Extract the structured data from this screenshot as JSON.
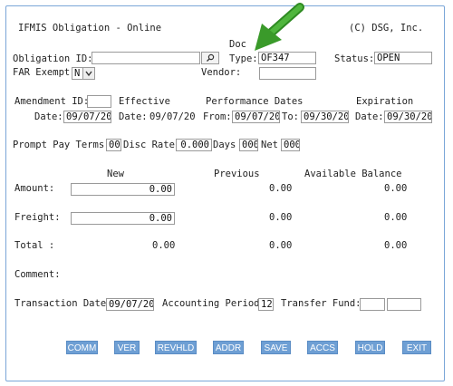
{
  "header": {
    "title": "IFMIS Obligation - Online",
    "copyright": "(C) DSG, Inc."
  },
  "row1": {
    "obligation_id_label": "Obligation ID:",
    "obligation_id_value": "",
    "doc_label": "Doc",
    "type_label": "Type:",
    "type_value": "OF347",
    "status_label": "Status:",
    "status_value": "OPEN"
  },
  "row2": {
    "far_label": "FAR Exempt:",
    "far_value": "N",
    "vendor_label": "Vendor:",
    "vendor_value": ""
  },
  "dates": {
    "amendment_id_label": "Amendment ID:",
    "amendment_id_value": "",
    "effective_label": "Effective",
    "performance_label": "Performance Dates",
    "expiration_label": "Expiration",
    "date_label": "Date:",
    "date_value": "09/07/20",
    "effective_date_label": "Date:",
    "effective_date_value": "09/07/20",
    "from_label": "From:",
    "from_value": "09/07/20",
    "to_label": "To:",
    "to_value": "09/30/20",
    "exp_date_label": "Date:",
    "exp_date_value": "09/30/20"
  },
  "terms": {
    "prompt_pay_label": "Prompt Pay Terms:",
    "prompt_pay_value": "00",
    "disc_rate_label": "Disc Rate",
    "disc_rate_value": "0.000",
    "days_label": "Days",
    "days_value": "000",
    "net_label": "Net",
    "net_value": "000"
  },
  "amounts": {
    "col_new": "New",
    "col_previous": "Previous",
    "col_available": "Available Balance",
    "rows": [
      {
        "label": "Amount:",
        "new": "0.00",
        "previous": "0.00",
        "available": "0.00"
      },
      {
        "label": "Freight:",
        "new": "0.00",
        "previous": "0.00",
        "available": "0.00"
      },
      {
        "label": "Total   :",
        "new": "0.00",
        "previous": "0.00",
        "available": "0.00"
      }
    ]
  },
  "comment_label": "Comment:",
  "footer_fields": {
    "transaction_date_label": "Transaction Date:",
    "transaction_date_value": "09/07/20",
    "accounting_period_label": "Accounting Period:",
    "accounting_period_value": "12",
    "transfer_fund_label": "Transfer Fund:",
    "transfer_fund_value_1": "",
    "transfer_fund_value_2": ""
  },
  "buttons": [
    "COMM",
    "VER",
    "REVHLD",
    "ADDR",
    "SAVE",
    "ACCS",
    "HOLD",
    "EXIT"
  ],
  "colors": {
    "frame_border": "#7aa6d8",
    "button_bg": "#6e9fd4",
    "arrow": "#3a9a2a"
  }
}
